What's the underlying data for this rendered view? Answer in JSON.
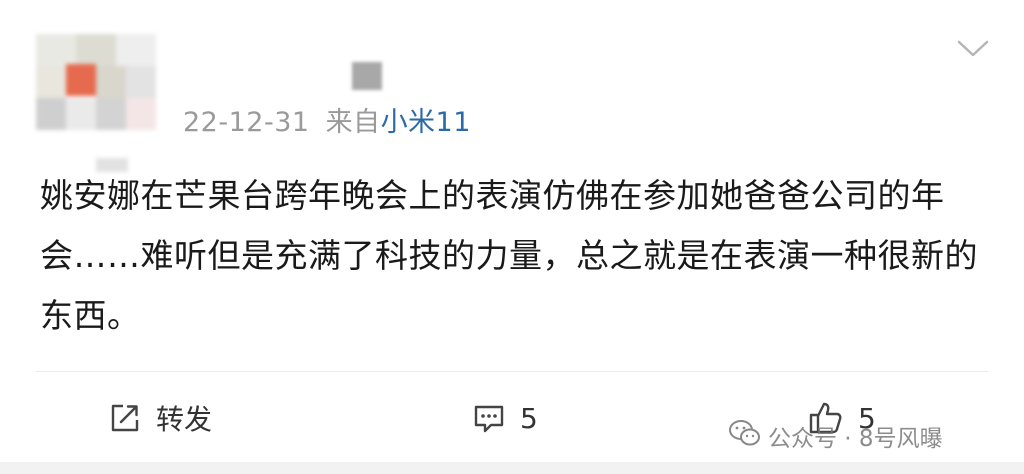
{
  "post": {
    "date": "22-12-31",
    "source_prefix": "来自",
    "device": "小米11",
    "content": "姚安娜在芒果台跨年晚会上的表演仿佛在参加她爸爸公司的年会……难听但是充满了科技的力量，总之就是在表演一种很新的东西。"
  },
  "actions": {
    "repost_label": "转发",
    "comment_count": "5",
    "like_count": "5"
  },
  "watermark": {
    "text": "公众号 · 8号风曝"
  },
  "colors": {
    "device_link": "#2a6aa8",
    "meta_gray": "#9a9a9a",
    "text": "#1a1a1a"
  },
  "icons": {
    "more": "chevron-down-icon",
    "repost": "share-arrow-icon",
    "comment": "comment-bubble-icon",
    "like": "thumbs-up-icon",
    "watermark": "wechat-icon"
  }
}
